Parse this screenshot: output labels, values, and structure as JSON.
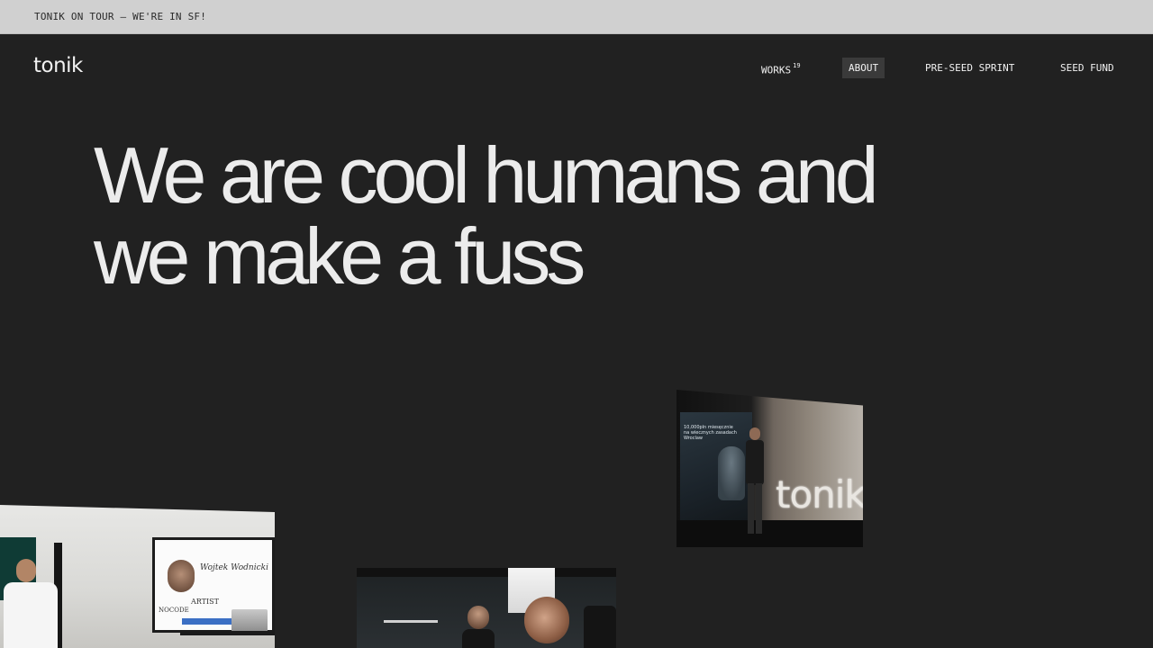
{
  "announcement": {
    "text": "TONIK ON TOUR – WE'RE IN SF!"
  },
  "header": {
    "logo": "tonik",
    "nav": [
      {
        "label": "WORKS",
        "count": "19"
      },
      {
        "label": "ABOUT",
        "active": true
      },
      {
        "label": "PRE-SEED SPRINT"
      },
      {
        "label": "SEED FUND"
      }
    ]
  },
  "hero": {
    "line1": "We are cool humans and",
    "line2": "we make a fuss"
  },
  "photos": {
    "stage": {
      "screen_text": "10,000pln miesęcznie na wiecznych zasadach Wroclaw",
      "letters": "tonik"
    },
    "presenter": {
      "screen_name": "Wojtek Wodnicki",
      "screen_role": "ARTIST",
      "screen_tag": "NOCODE"
    }
  },
  "colors": {
    "background": "#212121",
    "announcement_bar": "#d0d0d0",
    "text_light": "#ececec",
    "active_nav_bg": "#3a3a3a"
  }
}
